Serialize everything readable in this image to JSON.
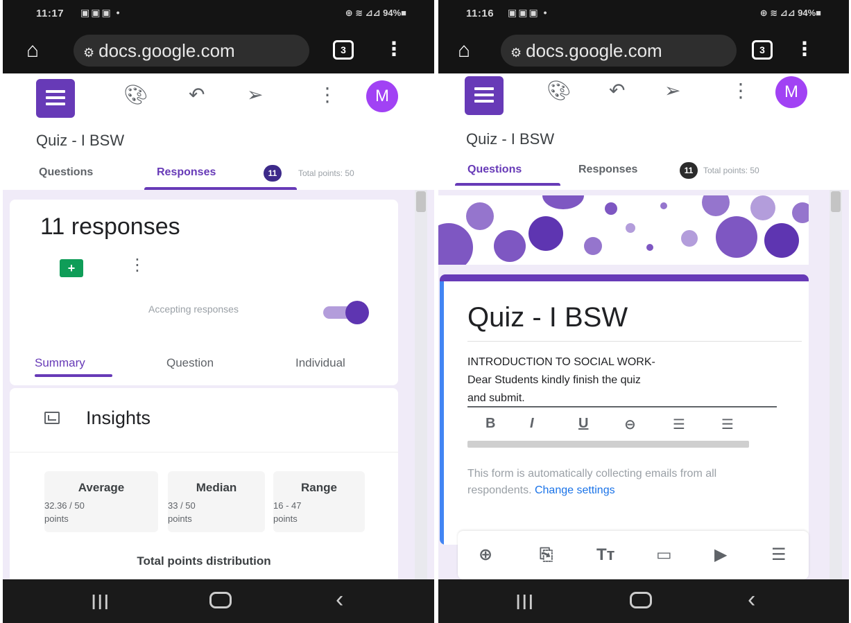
{
  "status_bar": {
    "left_time": "11:17",
    "right_time": "11:16",
    "notification_icons": "▣▣▣ •",
    "system_icons": "⊕ ≋ ⊿⊿ 94%■"
  },
  "browser": {
    "url": "docs.google.com",
    "tune_icon": "settings-tune-icon",
    "tabs_count": "3"
  },
  "app": {
    "avatar_initial": "M",
    "form_title": "Quiz - I BSW",
    "tabs": {
      "questions": "Questions",
      "responses": "Responses"
    },
    "response_badge": "11",
    "total_points": "Total points: 50",
    "accent_color": "#673ab7"
  },
  "left": {
    "responses_count": "11 responses",
    "accepting_label": "Accepting responses",
    "accepting_on": true,
    "subtabs": {
      "summary": "Summary",
      "question": "Question",
      "individual": "Individual"
    },
    "insights_title": "Insights",
    "stats": [
      {
        "label": "Average",
        "value": "32.36 / 50",
        "unit": "points"
      },
      {
        "label": "Median",
        "value": "33 / 50",
        "unit": "points"
      },
      {
        "label": "Range",
        "value": "16 - 47",
        "unit": "points"
      }
    ],
    "distribution_title": "Total points distribution"
  },
  "right": {
    "form_title": "Quiz - I BSW",
    "description_line1": "INTRODUCTION TO SOCIAL WORK-",
    "description_line2": "Dear Students kindly  finish the quiz",
    "description_line3": "and submit.",
    "format_buttons": [
      "B",
      "I",
      "U",
      "⊖",
      "☰",
      "☰"
    ],
    "collect_note": "This form is automatically collecting emails from all respondents.",
    "change_link": "Change settings"
  }
}
